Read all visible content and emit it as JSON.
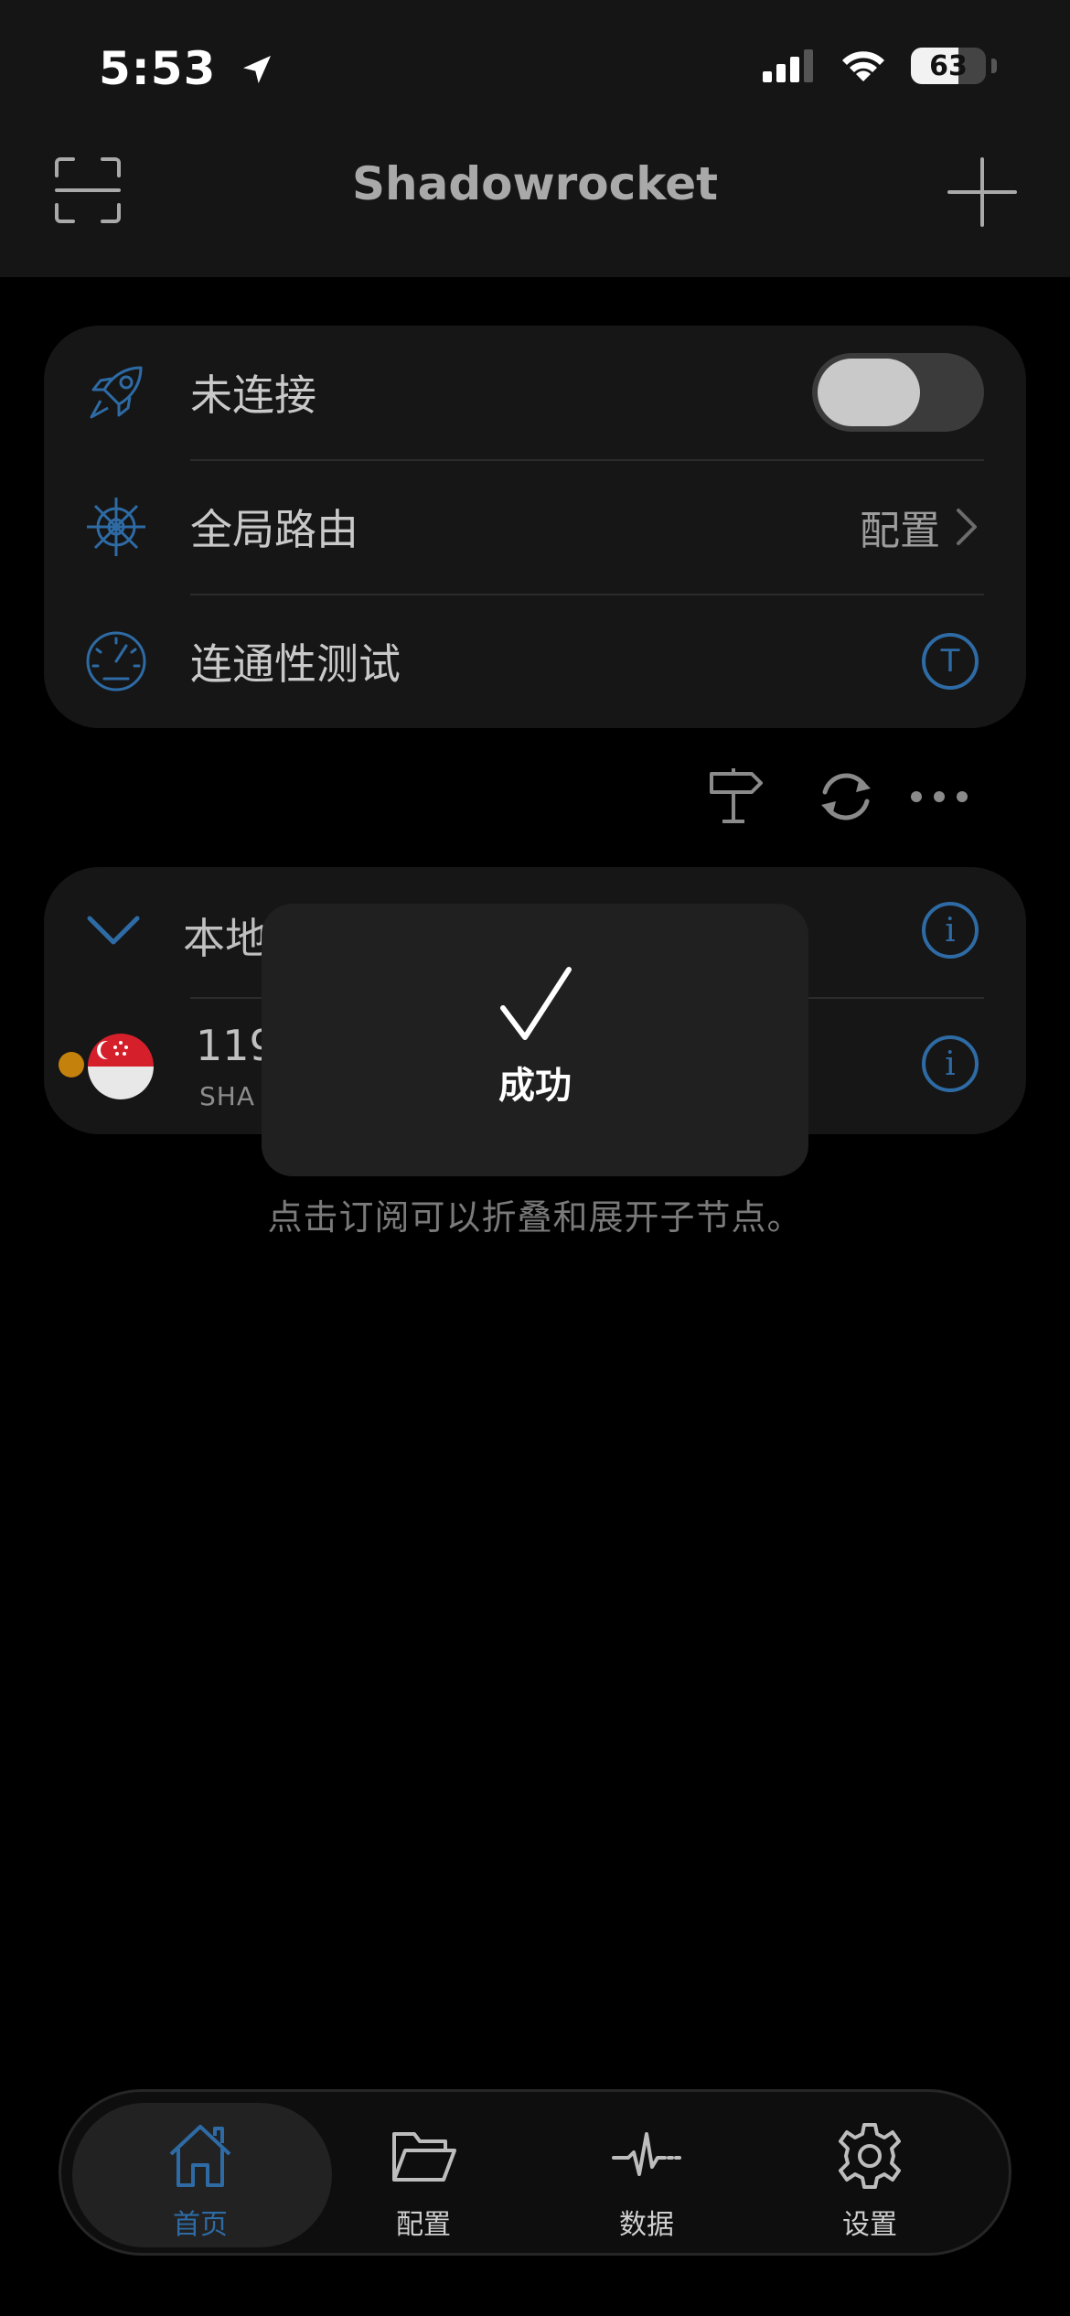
{
  "status_bar": {
    "time": "5:53",
    "battery": "63",
    "battery_level": 0.63,
    "location_icon": "location-arrow-icon",
    "signal_icon": "cellular-signal-icon",
    "wifi_icon": "wifi-icon"
  },
  "nav": {
    "title": "Shadowrocket",
    "scan_icon": "scan-icon",
    "add_icon": "plus-icon"
  },
  "main_card": {
    "connection_label": "未连接",
    "connection_icon": "rocket-icon",
    "toggle_on": false,
    "routing_label": "全局路由",
    "routing_icon": "ship-wheel-icon",
    "routing_value": "配置",
    "test_label": "连通性测试",
    "test_icon": "speedometer-icon",
    "test_badge": "T"
  },
  "toolbar": {
    "icons": [
      "signpost-icon",
      "refresh-icon",
      "more-icon"
    ]
  },
  "subscription": {
    "title": "本地",
    "info": "i",
    "node": {
      "ip": "119",
      "type": "SHA",
      "info": "i",
      "flag_icon": "singapore-flag-icon"
    }
  },
  "hint": "点击订阅可以折叠和展开子节点。",
  "toast": {
    "text": "成功",
    "icon": "checkmark-icon"
  },
  "tabs": [
    {
      "label": "首页",
      "icon": "home-icon",
      "active": true
    },
    {
      "label": "配置",
      "icon": "folder-icon",
      "active": false
    },
    {
      "label": "数据",
      "icon": "pulse-icon",
      "active": false
    },
    {
      "label": "设置",
      "icon": "gear-icon",
      "active": false
    }
  ],
  "colors": {
    "accent": "#2e6ba5",
    "background": "#000000",
    "card": "#161616",
    "node_dot": "#c4820d"
  }
}
